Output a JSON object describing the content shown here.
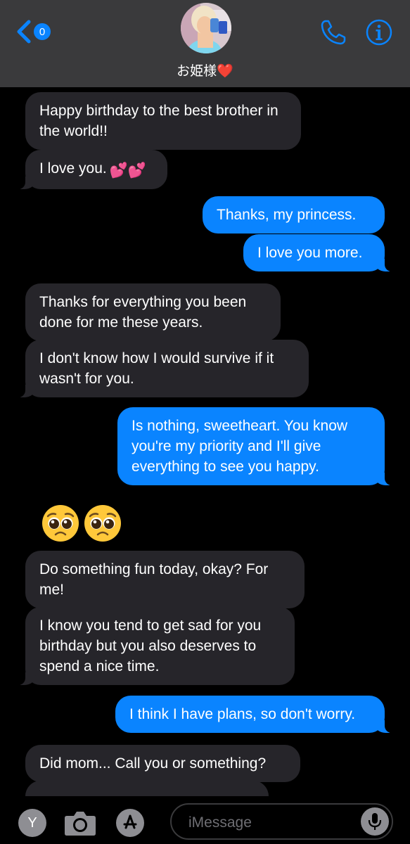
{
  "header": {
    "unread_count": "0",
    "contact_name": "お姫様❤️",
    "icons": {
      "back": "chevron-left-icon",
      "call": "phone-icon",
      "info": "info-icon"
    }
  },
  "messages": [
    {
      "id": "m1",
      "type": "received",
      "text": "Happy birthday to the best brother in the world!!"
    },
    {
      "id": "m2",
      "type": "received",
      "text": "I love you.",
      "emoji": "💕💕"
    },
    {
      "id": "m3",
      "type": "sent",
      "text": "Thanks, my princess."
    },
    {
      "id": "m4",
      "type": "sent",
      "text": "I love you more."
    },
    {
      "id": "m5",
      "type": "received",
      "text": "Thanks for everything you been done for me these years."
    },
    {
      "id": "m6",
      "type": "received",
      "text": "I don't know how I would survive if it wasn't for you."
    },
    {
      "id": "m7",
      "type": "sent",
      "text": "Is nothing, sweetheart. You know you're my priority and I'll give everything to see you happy."
    },
    {
      "id": "m8",
      "type": "emoji",
      "text": "🥺🥺"
    },
    {
      "id": "m9",
      "type": "received",
      "text": "Do something fun today, okay? For me!"
    },
    {
      "id": "m10",
      "type": "received",
      "text": "I know you tend to get sad for you birthday but you also deserves to spend a nice time."
    },
    {
      "id": "m11",
      "type": "sent",
      "text": "I think I have plans, so don't worry."
    },
    {
      "id": "m12",
      "type": "received",
      "text": "Did mom... Call you or something?"
    }
  ],
  "composer": {
    "app_button_label": "Y",
    "placeholder": "iMessage",
    "icons": {
      "camera": "camera-icon",
      "appstore": "appstore-icon",
      "mic": "microphone-icon"
    }
  },
  "colors": {
    "header_bg": "#3a3a3c",
    "sent_bubble": "#0a84ff",
    "received_bubble": "#26252a",
    "background": "#000000"
  }
}
